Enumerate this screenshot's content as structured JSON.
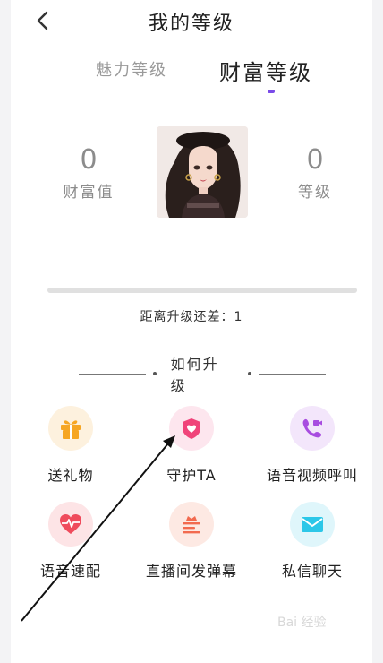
{
  "header": {
    "title": "我的等级"
  },
  "tabs": [
    {
      "label": "魅力等级",
      "active": false
    },
    {
      "label": "财富等级",
      "active": true
    }
  ],
  "stats": {
    "wealth_value": "0",
    "wealth_label": "财富值",
    "level_value": "0",
    "level_label": "等级"
  },
  "progress": {
    "fraction": 0,
    "gap_text": "距离升级还差：1"
  },
  "section": {
    "title": "如何升级"
  },
  "features": [
    {
      "label": "送礼物",
      "icon": "gift-icon",
      "color": "#f6a623"
    },
    {
      "label": "守护TA",
      "icon": "shield-heart-icon",
      "color": "#f0447a"
    },
    {
      "label": "语音视频呼叫",
      "icon": "video-call-icon",
      "color": "#a84ce0"
    },
    {
      "label": "语音速配",
      "icon": "heartbeat-icon",
      "color": "#ef4b5c"
    },
    {
      "label": "直播间发弹幕",
      "icon": "crown-danmaku-icon",
      "color": "#f26a4f"
    },
    {
      "label": "私信聊天",
      "icon": "mail-icon",
      "color": "#2cc7e8"
    }
  ],
  "colors": {
    "accent": "#7a4be8"
  },
  "watermark": "Bai 经验"
}
